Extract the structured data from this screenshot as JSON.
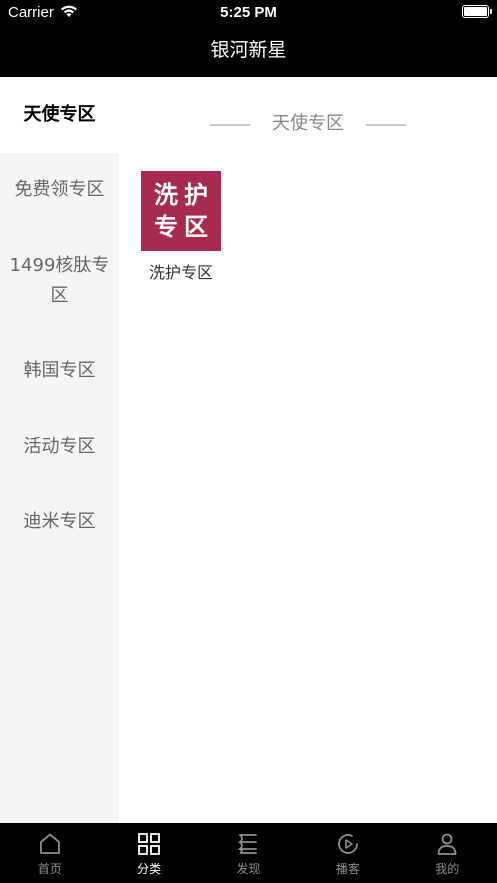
{
  "status_bar": {
    "carrier": "Carrier",
    "time": "5:25 PM"
  },
  "nav": {
    "title": "银河新星"
  },
  "sidebar": {
    "items": [
      {
        "label": "天使专区",
        "active": true
      },
      {
        "label": "免费领专区"
      },
      {
        "label": "1499核肽专区"
      },
      {
        "label": "韩国专区"
      },
      {
        "label": "活动专区"
      },
      {
        "label": "迪米专区"
      }
    ]
  },
  "content": {
    "section_title": "天使专区",
    "products": [
      {
        "image_text_line1": "洗护",
        "image_text_line2": "专区",
        "label": "洗护专区",
        "image_color": "#a72b50"
      }
    ]
  },
  "tab_bar": {
    "tabs": [
      {
        "label": "首页",
        "icon": "home-icon"
      },
      {
        "label": "分类",
        "icon": "grid-icon",
        "active": true
      },
      {
        "label": "发现",
        "icon": "discover-icon"
      },
      {
        "label": "播客",
        "icon": "podcast-icon"
      },
      {
        "label": "我的",
        "icon": "profile-icon"
      }
    ]
  }
}
